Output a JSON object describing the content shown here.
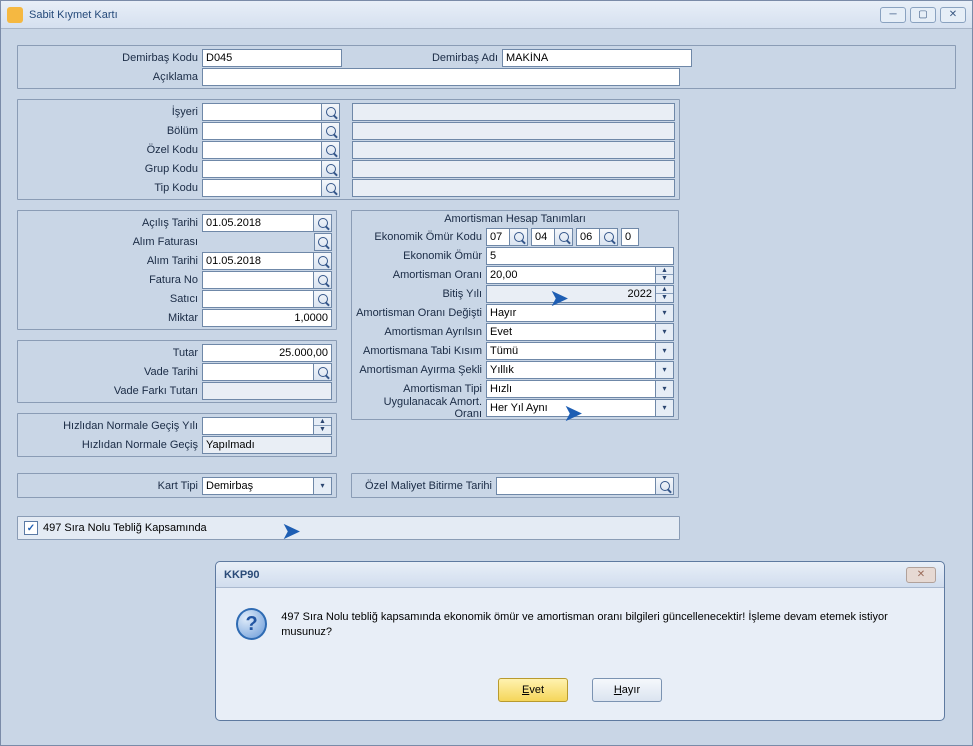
{
  "window": {
    "title": "Sabit Kıymet Kartı"
  },
  "top": {
    "demirbasKoduLabel": "Demirbaş Kodu",
    "demirbasKodu": "D045",
    "demirbasAdiLabel": "Demirbaş Adı",
    "demirbasAdi": "MAKİNA",
    "aciklamaLabel": "Açıklama",
    "aciklama": ""
  },
  "loc": {
    "isyeriLabel": "İşyeri",
    "isyeri": "",
    "bolumLabel": "Bölüm",
    "bolum": "",
    "ozelKoduLabel": "Özel Kodu",
    "ozelKodu": "",
    "grupKoduLabel": "Grup Kodu",
    "grupKodu": "",
    "tipKoduLabel": "Tip Kodu",
    "tipKodu": ""
  },
  "left": {
    "acilisTarihiLabel": "Açılış Tarihi",
    "acilisTarihi": "01.05.2018",
    "alimFaturasiLabel": "Alım Faturası",
    "alimTarihiLabel": "Alım Tarihi",
    "alimTarihi": "01.05.2018",
    "faturaNoLabel": "Fatura No",
    "faturaNo": "",
    "saticiLabel": "Satıcı",
    "satici": "",
    "miktarLabel": "Miktar",
    "miktar": "1,0000",
    "tutarLabel": "Tutar",
    "tutar": "25.000,00",
    "vadeTarihiLabel": "Vade Tarihi",
    "vadeTarihi": "",
    "vadeFarkiLabel": "Vade Farkı Tutarı",
    "vadeFarki": "",
    "hizNormYilLabel": "Hızlıdan Normale Geçiş Yılı",
    "hizNormYil": "",
    "hizNormGecisLabel": "Hızlıdan Normale Geçiş",
    "hizNormGecis": "Yapılmadı",
    "kartTipiLabel": "Kart Tipi",
    "kartTipi": "Demirbaş"
  },
  "right": {
    "header": "Amortisman Hesap Tanımları",
    "ekoOmurKoduLabel": "Ekonomik Ömür Kodu",
    "eok1": "07",
    "eok2": "04",
    "eok3": "06",
    "eok4": "0",
    "ekoOmurLabel": "Ekonomik Ömür",
    "ekoOmur": "5",
    "amortOranLabel": "Amortisman Oranı",
    "amortOran": "20,00",
    "bitisYiliLabel": "Bitiş Yılı",
    "bitisYili": "2022",
    "oranDegLabel": "Amortisman Oranı Değişti",
    "oranDeg": "Hayır",
    "ayrilsinLabel": "Amortisman Ayrılsın",
    "ayrilsin": "Evet",
    "tabiKisimLabel": "Amortismana Tabi Kısım",
    "tabiKisim": "Tümü",
    "ayirmaSekliLabel": "Amortisman Ayırma Şekli",
    "ayirmaSekli": "Yıllık",
    "amortTipiLabel": "Amortisman Tipi",
    "amortTipi": "Hızlı",
    "uygOranLabel": "Uygulanacak Amort. Oranı",
    "uygOran": "Her Yıl Aynı",
    "ozelMaliyetLabel": "Özel Maliyet Bitirme Tarihi",
    "ozelMaliyet": ""
  },
  "chk497": {
    "label": "497 Sıra Nolu Tebliğ Kapsamında",
    "checked": true
  },
  "dialog": {
    "title": "KKP90",
    "msg": "497 Sıra Nolu tebliğ kapsamında ekonomik ömür ve amortisman oranı bilgileri güncellenecektir! İşleme devam etemek istiyor musunuz?",
    "yesU": "E",
    "yesR": "vet",
    "noU": "H",
    "noR": "ayır"
  }
}
